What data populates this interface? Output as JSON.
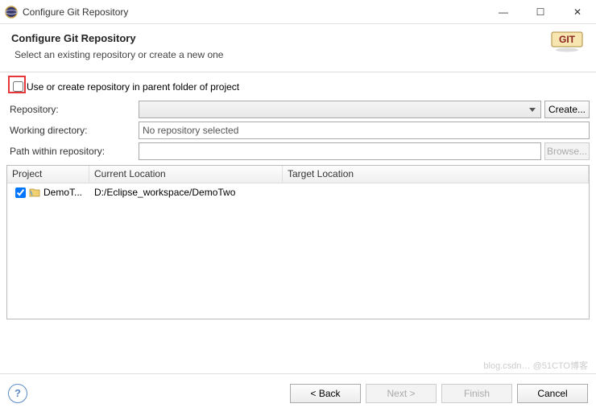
{
  "window": {
    "title": "Configure Git Repository",
    "min": "—",
    "max": "☐",
    "close": "✕"
  },
  "header": {
    "title": "Configure Git Repository",
    "subtitle": "Select an existing repository or create a new one"
  },
  "form": {
    "useParentLabel": "Use or create repository in parent folder of project",
    "repositoryLabel": "Repository:",
    "repositoryValue": "",
    "createBtn": "Create...",
    "workingDirLabel": "Working directory:",
    "workingDirValue": "No repository selected",
    "pathLabel": "Path within repository:",
    "pathValue": "",
    "browseBtn": "Browse..."
  },
  "table": {
    "colProject": "Project",
    "colCurrent": "Current Location",
    "colTarget": "Target Location",
    "rows": [
      {
        "project": "DemoT...",
        "current": "D:/Eclipse_workspace/DemoTwo",
        "target": ""
      }
    ]
  },
  "buttons": {
    "back": "< Back",
    "next": "Next >",
    "finish": "Finish",
    "cancel": "Cancel"
  },
  "watermark": "blog.csdn… @51CTO博客"
}
